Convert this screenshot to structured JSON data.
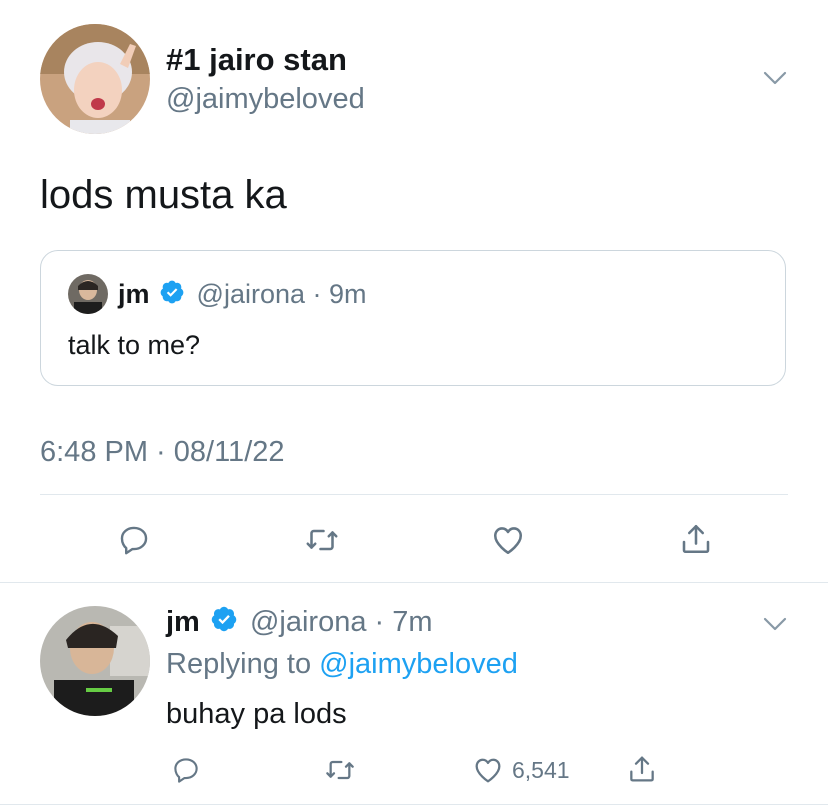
{
  "main_tweet": {
    "display_name": "#1 jairo stan",
    "handle": "@jaimybeloved",
    "text": "lods musta ka",
    "timestamp": "6:48 PM · 08/11/22",
    "quoted": {
      "display_name": "jm",
      "handle": "@jairona",
      "time": "· 9m",
      "text": "talk to me?"
    },
    "actions": [
      "reply-icon",
      "retweet-icon",
      "like-icon",
      "share-icon"
    ]
  },
  "reply_tweet": {
    "display_name": "jm",
    "handle": "@jairona",
    "time": "· 7m",
    "replying_prefix": "Replying to",
    "replying_to": "@jaimybeloved",
    "text": "buhay pa lods",
    "like_count": "6,541"
  },
  "colors": {
    "text": "#14171a",
    "secondary": "#657786",
    "accent": "#1da1f2",
    "divider": "#e1e8ed"
  }
}
